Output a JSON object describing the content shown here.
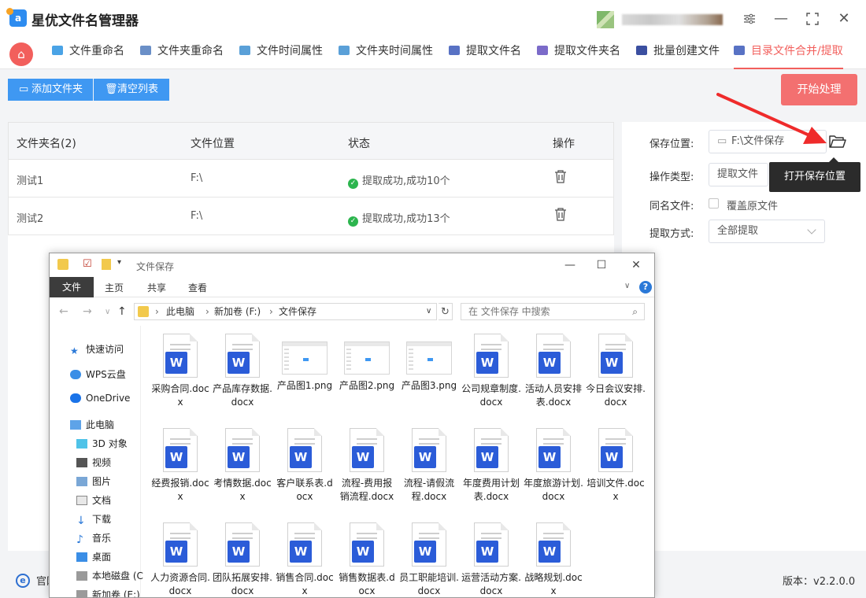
{
  "app": {
    "title": "星优文件名管理器",
    "logo_letter": "a"
  },
  "tabs": [
    {
      "label": "文件重命名",
      "color": "#4aa3e6"
    },
    {
      "label": "文件夹重命名",
      "color": "#6a8fc7"
    },
    {
      "label": "文件时间属性",
      "color": "#5aa0d8"
    },
    {
      "label": "文件夹时间属性",
      "color": "#5aa0d8"
    },
    {
      "label": "提取文件名",
      "color": "#5872c4"
    },
    {
      "label": "提取文件夹名",
      "color": "#7b6bc9"
    },
    {
      "label": "批量创建文件",
      "color": "#3b4fa0"
    },
    {
      "label": "目录文件合并/提取",
      "color": "#5872c4"
    }
  ],
  "toolbar": {
    "add_folder": "添加文件夹",
    "clear_list": "清空列表",
    "start": "开始处理"
  },
  "table": {
    "headers": [
      "文件夹名(2)",
      "文件位置",
      "状态",
      "操作"
    ],
    "rows": [
      {
        "name": "测试1",
        "location": "F:\\",
        "status": "提取成功,成功10个"
      },
      {
        "name": "测试2",
        "location": "F:\\",
        "status": "提取成功,成功13个"
      }
    ]
  },
  "settings": {
    "save_location_label": "保存位置:",
    "save_location_value": "F:\\文件保存",
    "operation_type_label": "操作类型:",
    "operation_type_value": "提取文件",
    "duplicate_label": "同名文件:",
    "overwrite_label": "覆盖原文件",
    "extract_mode_label": "提取方式:",
    "extract_mode_value": "全部提取",
    "tooltip": "打开保存位置"
  },
  "statusbar": {
    "site": "官网",
    "version": "版本：v2.2.0.0"
  },
  "explorer": {
    "title": "文件保存",
    "ribbon": [
      "文件",
      "主页",
      "共享",
      "查看"
    ],
    "breadcrumb": [
      "此电脑",
      "新加卷 (F:)",
      "文件保存"
    ],
    "search_placeholder": "在 文件保存 中搜索",
    "nav": [
      "快速访问",
      "WPS云盘",
      "OneDrive",
      "此电脑",
      "3D 对象",
      "视频",
      "图片",
      "文档",
      "下载",
      "音乐",
      "桌面",
      "本地磁盘 (C",
      "新加卷 (E:)"
    ],
    "files": [
      {
        "name": "采购合同.docx",
        "type": "docx"
      },
      {
        "name": "产品库存数据.docx",
        "type": "docx"
      },
      {
        "name": "产品图1.png",
        "type": "png"
      },
      {
        "name": "产品图2.png",
        "type": "png"
      },
      {
        "name": "产品图3.png",
        "type": "png"
      },
      {
        "name": "公司规章制度.docx",
        "type": "docx"
      },
      {
        "name": "活动人员安排表.docx",
        "type": "docx"
      },
      {
        "name": "今日会议安排.docx",
        "type": "docx"
      },
      {
        "name": "经费报销.docx",
        "type": "docx"
      },
      {
        "name": "考情数据.docx",
        "type": "docx"
      },
      {
        "name": "客户联系表.docx",
        "type": "docx"
      },
      {
        "name": "流程-费用报销流程.docx",
        "type": "docx"
      },
      {
        "name": "流程-请假流程.docx",
        "type": "docx"
      },
      {
        "name": "年度费用计划表.docx",
        "type": "docx"
      },
      {
        "name": "年度旅游计划.docx",
        "type": "docx"
      },
      {
        "name": "培训文件.docx",
        "type": "docx"
      },
      {
        "name": "人力资源合同.docx",
        "type": "docx"
      },
      {
        "name": "团队拓展安排.docx",
        "type": "docx"
      },
      {
        "name": "销售合同.docx",
        "type": "docx"
      },
      {
        "name": "销售数据表.docx",
        "type": "docx"
      },
      {
        "name": "员工职能培训.docx",
        "type": "docx"
      },
      {
        "name": "运营活动方案.docx",
        "type": "docx"
      },
      {
        "name": "战略规划.docx",
        "type": "docx"
      }
    ]
  }
}
